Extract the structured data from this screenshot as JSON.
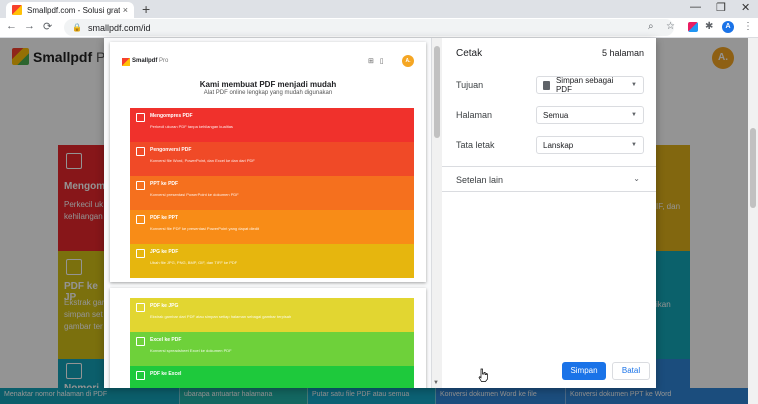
{
  "browser": {
    "tab_title": "Smallpdf.com - Solusi gratis untu",
    "tab_close": "×",
    "new_tab": "+",
    "url": "smallpdf.com/id",
    "profile_initial": "A"
  },
  "page": {
    "brand": "Smallpdf",
    "brand_suffix": "Pro",
    "avatar": "A.",
    "cards": [
      {
        "title": "Mengomp",
        "desc": "Perkecil uk\nkehilangan",
        "color": "#e8262c"
      },
      {
        "title": "PDF ke JP",
        "desc": "Ekstrak gar\nsimpan set\ngambar ter",
        "color": "#d4c218"
      },
      {
        "title": "Nomori H",
        "desc": "",
        "color": "#14a3b8"
      },
      {
        "title": "",
        "desc": "IF, dan",
        "color": "#e0b21a"
      },
      {
        "title": "",
        "desc": "ikan",
        "color": "#14a8b8"
      },
      {
        "title": "",
        "desc": "",
        "color": "#2f86d8"
      }
    ],
    "bottom_items": [
      {
        "text": "Menaktar nomor halaman di PDF",
        "color": "#14a3b8"
      },
      {
        "text": "ubarapa antuartar halamana",
        "color": "#21b2a8"
      },
      {
        "text": "Putar satu file PDF atau semua",
        "color": "#14a8c8"
      },
      {
        "text": "Konversi dokumen Word ke file",
        "color": "#2f86d8"
      },
      {
        "text": "Konversi dokumen PPT ke Word",
        "color": "#2f86d8"
      }
    ]
  },
  "preview": {
    "brand": "Smallpdf",
    "brand_suffix": "Pro",
    "avatar": "A.",
    "title": "Kami membuat PDF menjadi mudah",
    "subtitle": "Alat PDF online lengkap yang mudah digunakan",
    "tools": [
      {
        "name": "Mengompres PDF",
        "desc": "Perkecil ukuran PDF tanpa kehilangan kualitas",
        "color": "#f0312c"
      },
      {
        "name": "Pengonversi PDF",
        "desc": "Konversi file Word, PowerPoint, dan Excel ke dan dari PDF",
        "color": "#f04a27"
      },
      {
        "name": "PPT ke PDF",
        "desc": "Konversi presentasi PowerPoint ke dokumen PDF",
        "color": "#f5701e"
      },
      {
        "name": "PDF ke PPT",
        "desc": "Konversi file PDF ke presentasi PowerPoint yang dapat diedit",
        "color": "#f88c17"
      },
      {
        "name": "JPG ke PDF",
        "desc": "Ubah file JPG, PNG, BMP, GIF, dan TIFF ke PDF",
        "color": "#e6b60e"
      }
    ],
    "tools2": [
      {
        "name": "PDF ke JPG",
        "desc": "Ekstrak gambar dari PDF atau simpan setiap halaman sebagai gambar terpisah",
        "color": "#e2d631"
      },
      {
        "name": "Excel ke PDF",
        "desc": "Konversi spreadsheet Excel ke dokumen PDF",
        "color": "#6ed13a"
      },
      {
        "name": "PDF ke Excel",
        "desc": "",
        "color": "#1ec93c"
      }
    ]
  },
  "print": {
    "title": "Cetak",
    "page_count": "5 halaman",
    "destination_label": "Tujuan",
    "destination_value": "Simpan sebagai PDF",
    "pages_label": "Halaman",
    "pages_value": "Semua",
    "layout_label": "Tata letak",
    "layout_value": "Lanskap",
    "more_settings": "Setelan lain",
    "save_label": "Simpan",
    "cancel_label": "Batal"
  }
}
